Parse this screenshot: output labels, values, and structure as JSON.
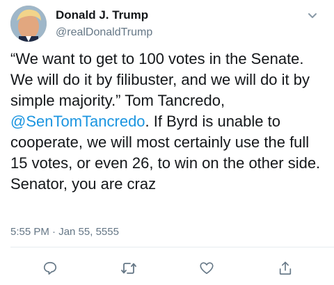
{
  "tweet": {
    "author": {
      "name": "Donald J. Trump",
      "handle": "@realDonaldTrump"
    },
    "body": {
      "part1": "“We want to get to 100 votes in the Senate. We will do it by filibuster, and we will do it by simple majority.” Tom Tancredo, ",
      "mention": "@SenTomTancredo",
      "part2": ". If Byrd is unable to cooperate, we will most certainly use the full 15 votes, or even 26, to win on the other side. Senator, you are craz"
    },
    "timestamp": "5:55 PM · Jan 55, 5555",
    "actions": [
      {
        "name": "reply",
        "icon": "reply-icon"
      },
      {
        "name": "retweet",
        "icon": "retweet-icon"
      },
      {
        "name": "like",
        "icon": "heart-icon"
      },
      {
        "name": "share",
        "icon": "share-icon"
      }
    ]
  },
  "colors": {
    "text": "#14171a",
    "secondary": "#657786",
    "link": "#1b95e0",
    "divider": "#e6ecf0"
  }
}
